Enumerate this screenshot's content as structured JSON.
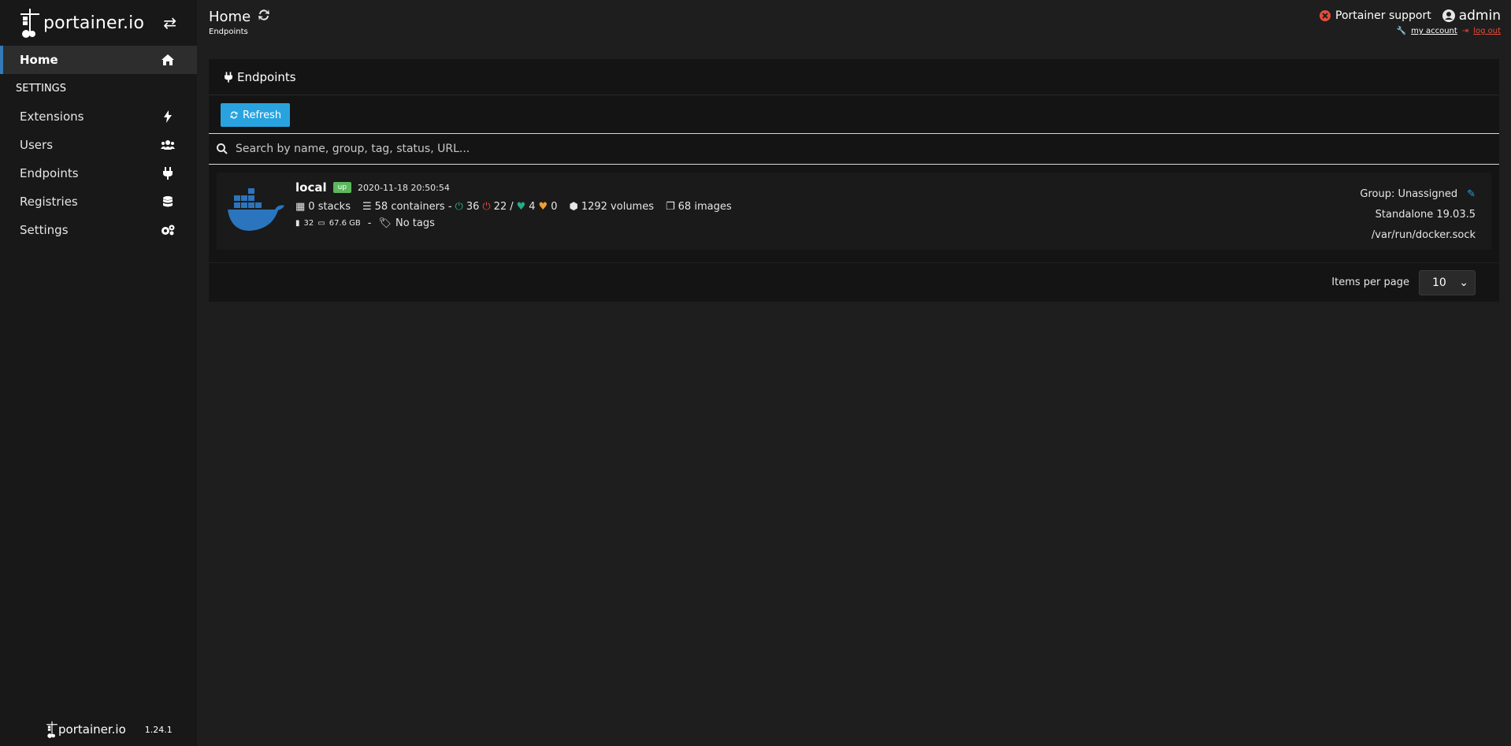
{
  "sidebar": {
    "brand": "portainer.io",
    "items": [
      {
        "label": "Home"
      },
      {
        "label": "Extensions"
      },
      {
        "label": "Users"
      },
      {
        "label": "Endpoints"
      },
      {
        "label": "Registries"
      },
      {
        "label": "Settings"
      }
    ],
    "section_heading": "SETTINGS",
    "footer_brand": "portainer.io",
    "version": "1.24.1"
  },
  "header": {
    "title": "Home",
    "breadcrumb": "Endpoints",
    "support_label": "Portainer support",
    "username": "admin",
    "my_account": "my account",
    "log_out": "log out"
  },
  "panel": {
    "title": "Endpoints",
    "refresh_label": "Refresh",
    "search_placeholder": "Search by name, group, tag, status, URL..."
  },
  "endpoint": {
    "name": "local",
    "status": "up",
    "timestamp": "2020-11-18 20:50:54",
    "stacks": "0 stacks",
    "containers": "58 containers -",
    "running": "36",
    "stopped": "22",
    "separator": "/",
    "healthy": "4",
    "unhealthy": "0",
    "volumes": "1292 volumes",
    "images": "68 images",
    "cpu": "32",
    "memory": "67.6 GB",
    "dash": "-",
    "tags": "No tags",
    "group": "Group: Unassigned",
    "engine": "Standalone 19.03.5",
    "url": "/var/run/docker.sock"
  },
  "pagination": {
    "label": "Items per page",
    "value": "10"
  },
  "colors": {
    "accent": "#337ab7",
    "button": "#28a3e0",
    "up_badge": "#5cb85c",
    "running": "#23ae89",
    "stopped": "#e74c3c",
    "unhealthy": "#f0a030",
    "docker_blue": "#2a75bd"
  }
}
